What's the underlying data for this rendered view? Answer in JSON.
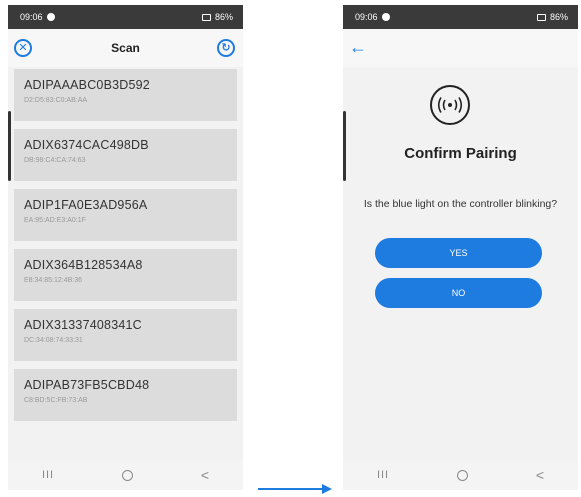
{
  "left_screen": {
    "status": {
      "time": "09:06",
      "battery": "86%"
    },
    "header": {
      "title": "Scan",
      "close_icon": "close-circle-icon",
      "refresh_icon": "refresh-icon"
    },
    "devices": [
      {
        "name": "ADIPAAABC0B3D592",
        "mac": "D2:D5:83:C0:AB:AA"
      },
      {
        "name": "ADIX6374CAC498DB",
        "mac": "DB:98:C4:CA:74:63"
      },
      {
        "name": "ADIP1FA0E3AD956A",
        "mac": "EA:95:AD:E3:A0:1F"
      },
      {
        "name": "ADIX364B128534A8",
        "mac": "E8:34:85:12:4B:36"
      },
      {
        "name": "ADIX31337408341C",
        "mac": "DC:34:08:74:33:31"
      },
      {
        "name": "ADIPAB73FB5CBD48",
        "mac": "C8:BD:5C:FB:73:AB"
      }
    ],
    "nav": {
      "recents": "III",
      "home": "O",
      "back": "<"
    }
  },
  "right_screen": {
    "status": {
      "time": "09:06",
      "battery": "86%"
    },
    "back_icon": "back-arrow-icon",
    "title": "Confirm Pairing",
    "question": "Is the blue light on the controller blinking?",
    "yes_label": "YES",
    "no_label": "NO",
    "nav": {
      "recents": "III",
      "home": "O",
      "back": "<"
    }
  },
  "colors": {
    "accent": "#1e7be0",
    "card": "#dcdcdc",
    "status_bar": "#3a3a3a"
  }
}
